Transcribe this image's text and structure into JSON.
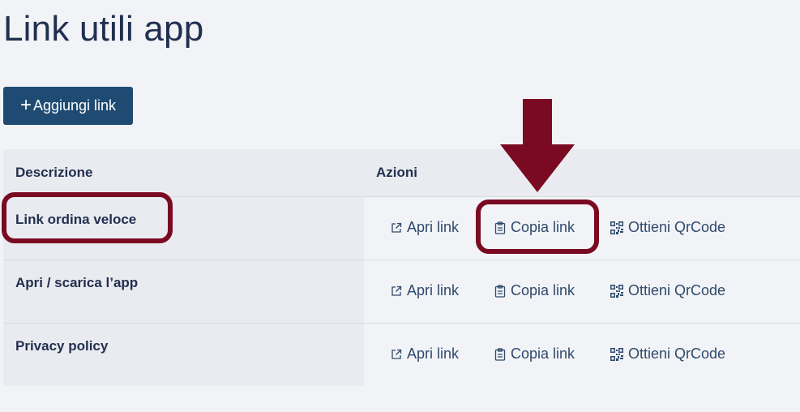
{
  "page": {
    "title": "Link utili app"
  },
  "toolbar": {
    "add_label": "Aggiungi link",
    "add_icon": "plus-icon"
  },
  "table": {
    "headers": {
      "description": "Descrizione",
      "actions": "Azioni"
    },
    "rows": [
      {
        "description": "Link ordina veloce",
        "open_label": "Apri link",
        "copy_label": "Copia link",
        "qr_label": "Ottieni QrCode"
      },
      {
        "description": "Apri / scarica l’app",
        "open_label": "Apri link",
        "copy_label": "Copia link",
        "qr_label": "Ottieni QrCode"
      },
      {
        "description": "Privacy policy",
        "open_label": "Apri link",
        "copy_label": "Copia link",
        "qr_label": "Ottieni QrCode"
      }
    ]
  },
  "annotation": {
    "color": "#7a0a22",
    "arrow_icon": "down-arrow-icon"
  },
  "colors": {
    "primary_button": "#1f4b73",
    "background": "#f2f3f7",
    "text_dark": "#22304f",
    "link_text": "#2e4a6b"
  }
}
